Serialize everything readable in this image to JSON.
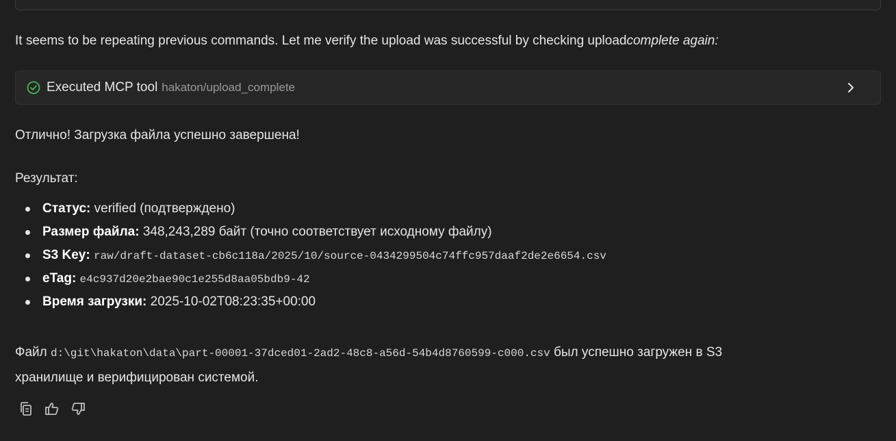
{
  "message": {
    "intro_text": "It seems to be repeating previous commands. Let me verify the upload was successful by checking upload",
    "intro_italic": "complete again:",
    "tool_call": {
      "label": "Executed MCP tool",
      "path": "hakaton/upload_complete",
      "status_icon": "check-circle-icon",
      "expand_icon": "chevron-right-icon"
    },
    "success_text": "Отлично! Загрузка файла успешно завершена!",
    "result_heading": "Результат:",
    "results": [
      {
        "key": "Статус",
        "value": " verified (подтверждено)",
        "mono": false
      },
      {
        "key": "Размер файла",
        "value": " 348,243,289 байт (точно соответствует исходному файлу)",
        "mono": false
      },
      {
        "key": "S3 Key",
        "value": "raw/draft-dataset-cb6c118a/2025/10/source-0434299504c74ffc957daaf2de2e6654.csv",
        "mono": true
      },
      {
        "key": "eTag",
        "value": "e4c937d20e2bae90c1e255d8aa05bdb9-42",
        "mono": true
      },
      {
        "key": "Время загрузки",
        "value": " 2025-10-02T08:23:35+00:00",
        "mono": false
      }
    ],
    "footer_prefix": "Файл ",
    "footer_path": "d:\\git\\hakaton\\data\\part-00001-37dced01-2ad2-48c8-a56d-54b4d8760599-c000.csv",
    "footer_suffix": " был успешно загружен в S3",
    "footer_line2": "хранилище и верифицирован системой."
  },
  "actions": [
    {
      "name": "copy-icon"
    },
    {
      "name": "thumbs-up-icon"
    },
    {
      "name": "thumbs-down-icon"
    }
  ],
  "colors": {
    "background": "#1f1f1f",
    "success_green": "#3fb950",
    "muted_text": "#9a9a9a"
  }
}
